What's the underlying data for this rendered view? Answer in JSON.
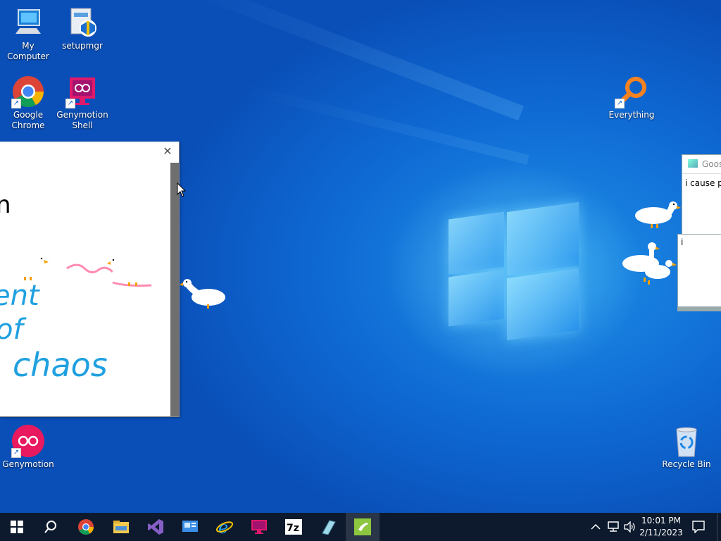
{
  "desktop_icons": [
    {
      "label": "My Computer",
      "icon": "computer-icon"
    },
    {
      "label": "setupmgr",
      "icon": "setup-icon"
    },
    {
      "label": "Google Chrome",
      "icon": "chrome-icon"
    },
    {
      "label": "Genymotion Shell",
      "icon": "genymotion-shell-icon"
    },
    {
      "label": "Everything",
      "icon": "everything-search-icon"
    },
    {
      "label": "Genymotion",
      "icon": "genymotion-icon"
    },
    {
      "label": "Recycle Bin",
      "icon": "recycle-bin-icon"
    }
  ],
  "paint_window": {
    "close_label": "✕",
    "drawn_text_lines": [
      "n",
      "ent",
      "of",
      "chaos"
    ]
  },
  "goose_window": {
    "title": "Goos",
    "message": "i cause p"
  },
  "goose_window2": {
    "text": "i"
  },
  "taskbar": {
    "items": [
      "start-icon",
      "search-icon",
      "chrome-icon",
      "file-explorer-icon",
      "visual-studio-icon",
      "control-panel-icon",
      "internet-explorer-icon",
      "genymotion-shell-icon",
      "7zip-icon",
      "notepad-icon",
      "goose-app-icon"
    ],
    "time": "10:01 PM",
    "date": "2/11/2023"
  },
  "colors": {
    "accent": "#0f6ad4",
    "taskbar": "#0d1a2e"
  }
}
